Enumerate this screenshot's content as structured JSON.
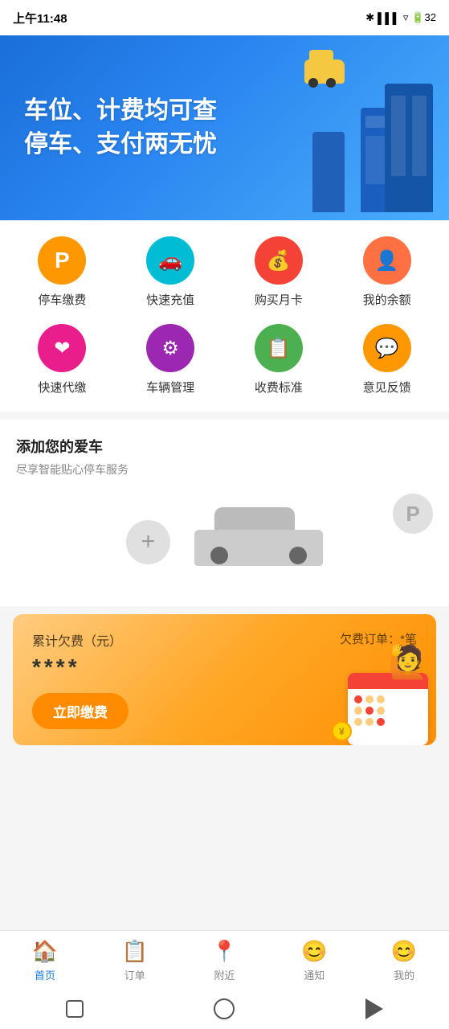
{
  "statusBar": {
    "time": "上午11:48",
    "icons": "🔵 ▲ ≦ ≦"
  },
  "banner": {
    "line1": "车位、计费均可查",
    "line2": "停车、支付两无忧"
  },
  "menuRow1": [
    {
      "id": "parking-fee",
      "label": "停车缴费",
      "iconClass": "icon-parking",
      "icon": "🅿"
    },
    {
      "id": "fast-recharge",
      "label": "快速充值",
      "iconClass": "icon-recharge",
      "icon": "🚗"
    },
    {
      "id": "buy-monthly",
      "label": "购买月卡",
      "iconClass": "icon-monthly",
      "icon": "💰"
    },
    {
      "id": "my-balance",
      "label": "我的余额",
      "iconClass": "icon-balance",
      "icon": "👤"
    }
  ],
  "menuRow2": [
    {
      "id": "fast-proxy",
      "label": "快速代缴",
      "iconClass": "icon-proxy",
      "icon": "❤"
    },
    {
      "id": "car-manage",
      "label": "车辆管理",
      "iconClass": "icon-manage",
      "icon": "⚙"
    },
    {
      "id": "fee-standard",
      "label": "收费标准",
      "iconClass": "icon-fee",
      "icon": "📋"
    },
    {
      "id": "feedback",
      "label": "意见反馈",
      "iconClass": "icon-feedback",
      "icon": "💬"
    }
  ],
  "addCar": {
    "title": "添加您的爱车",
    "subtitle": "尽享智能贴心停车服务",
    "addIcon": "+"
  },
  "feeBanner": {
    "label": "累计欠费（元）",
    "amount": "****",
    "orderLabel": "欠费订单：*笔",
    "payButton": "立即缴费"
  },
  "bottomNav": {
    "items": [
      {
        "id": "home",
        "label": "首页",
        "icon": "🏠",
        "active": true
      },
      {
        "id": "order",
        "label": "订单",
        "icon": "📋",
        "active": false
      },
      {
        "id": "nearby",
        "label": "附近",
        "icon": "📍",
        "active": false
      },
      {
        "id": "notify",
        "label": "通知",
        "icon": "😊",
        "active": false
      },
      {
        "id": "mine",
        "label": "我的",
        "icon": "😊",
        "active": false
      }
    ]
  }
}
